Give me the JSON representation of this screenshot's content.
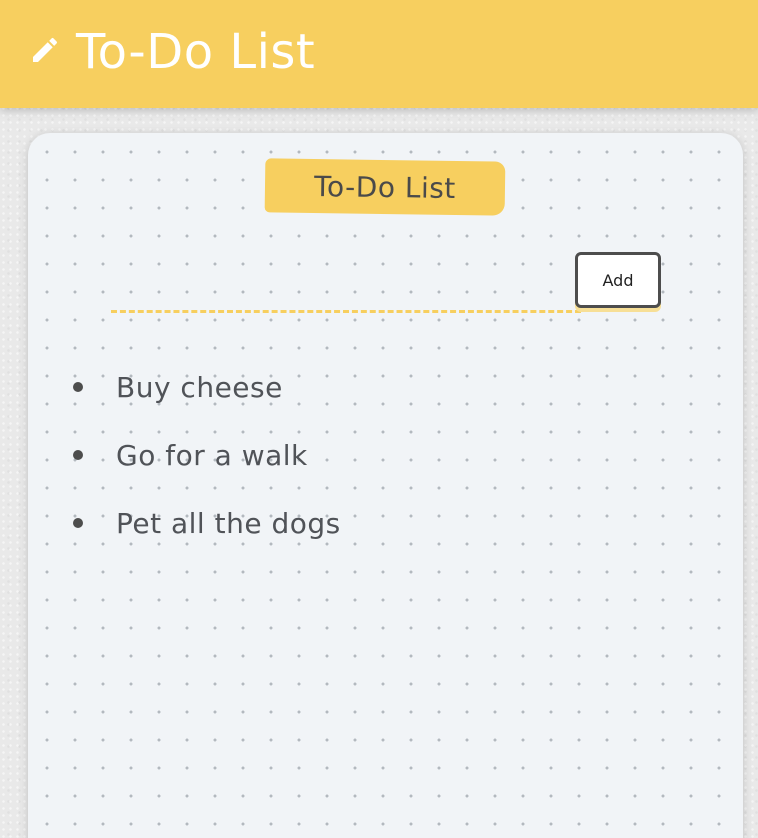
{
  "app": {
    "title": "To-Do List",
    "icon": "pencil-icon",
    "accent_color": "#f7cf5f"
  },
  "card": {
    "title": "To-Do List"
  },
  "input": {
    "value": "",
    "placeholder": ""
  },
  "add_button": {
    "label": "Add"
  },
  "todos": [
    {
      "text": "Buy cheese"
    },
    {
      "text": "Go for a walk"
    },
    {
      "text": "Pet all the dogs"
    }
  ]
}
